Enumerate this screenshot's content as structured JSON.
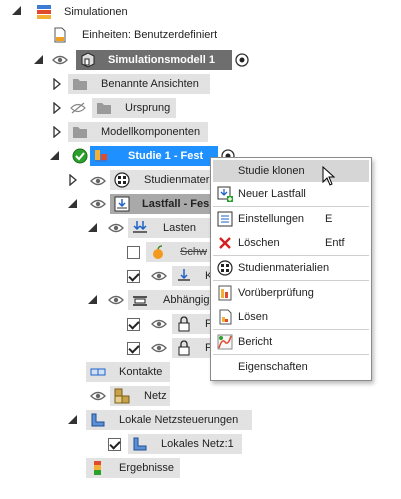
{
  "tree": {
    "root": "Simulationen",
    "units": "Einheiten: Benutzerdefiniert",
    "model": "Simulationsmodell 1",
    "named_views": "Benannte Ansichten",
    "origin": "Ursprung",
    "components": "Modellkomponenten",
    "study": "Studie 1 - Fest",
    "study_materials": "Studienmateri",
    "loadcase": "Lastfall - Fes",
    "loads": "Lasten",
    "gravity": "Schw",
    "load_k": "K",
    "dependent": "Abhängig",
    "constraint_f1": "F",
    "constraint_f2": "F",
    "contacts": "Kontakte",
    "mesh": "Netz",
    "local_mesh_controls": "Lokale Netzsteuerungen",
    "local_mesh": "Lokales Netz:1",
    "results": "Ergebnisse"
  },
  "context_menu": {
    "items": [
      {
        "label": "Studie klonen",
        "shortcut": "",
        "icon": "clone-icon"
      },
      {
        "label": "Neuer Lastfall",
        "shortcut": "",
        "icon": "new-loadcase-icon"
      },
      {
        "label": "Einstellungen",
        "shortcut": "E",
        "icon": "settings-list-icon"
      },
      {
        "label": "Löschen",
        "shortcut": "Entf",
        "icon": "delete-icon"
      },
      {
        "label": "Studienmaterialien",
        "shortcut": "",
        "icon": "materials-icon"
      },
      {
        "label": "Vorüberprüfung",
        "shortcut": "",
        "icon": "precheck-icon"
      },
      {
        "label": "Lösen",
        "shortcut": "",
        "icon": "solve-icon"
      },
      {
        "label": "Bericht",
        "shortcut": "",
        "icon": "report-icon"
      },
      {
        "label": "Eigenschaften",
        "shortcut": "",
        "icon": ""
      }
    ]
  },
  "colors": {
    "selection": "#1e90ff",
    "row_gray": "#e2e2e2",
    "model_row": "#6e6e6e",
    "loadcase_row": "#a9a9a9",
    "check_green": "#2ca02c"
  }
}
